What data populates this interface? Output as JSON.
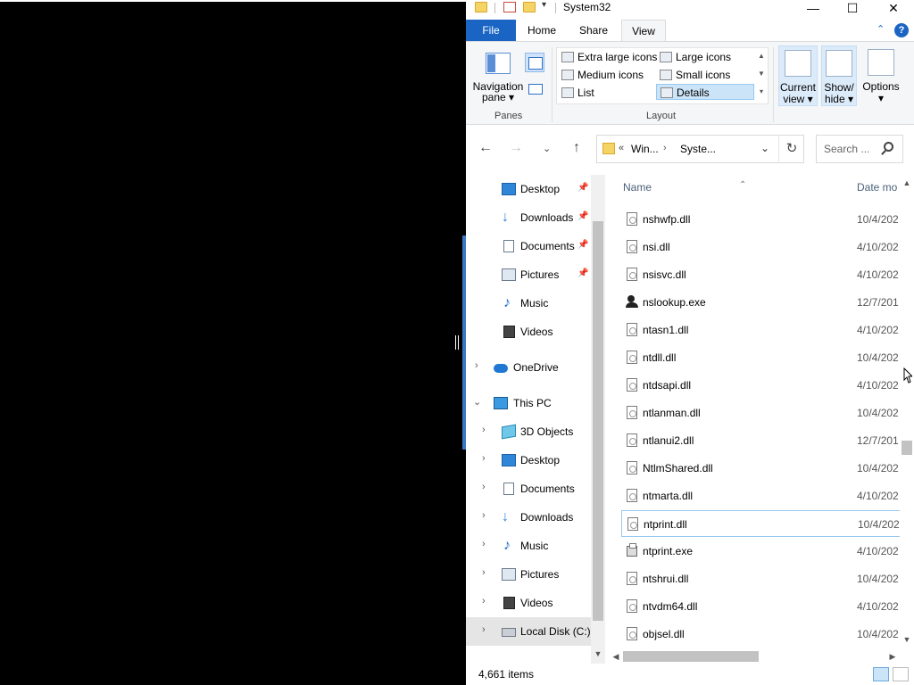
{
  "window": {
    "title": "System32",
    "minimize": "—",
    "maximize": "☐",
    "close": "✕"
  },
  "ribbon": {
    "tabs": {
      "file": "File",
      "home": "Home",
      "share": "Share",
      "view": "View"
    },
    "panes": {
      "navigation_pane": "Navigation pane",
      "group_label": "Panes"
    },
    "layout": {
      "group_label": "Layout",
      "options": [
        {
          "label": "Extra large icons",
          "selected": false
        },
        {
          "label": "Large icons",
          "selected": false
        },
        {
          "label": "Medium icons",
          "selected": false
        },
        {
          "label": "Small icons",
          "selected": false
        },
        {
          "label": "List",
          "selected": false
        },
        {
          "label": "Details",
          "selected": true
        }
      ]
    },
    "current_view": "Current view",
    "show_hide": "Show/ hide",
    "options": "Options"
  },
  "address": {
    "chevrons": "«",
    "segments": [
      "Win...",
      "Syste..."
    ],
    "separator": "›"
  },
  "search": {
    "placeholder": "Search ..."
  },
  "nav": {
    "quick_access": [
      {
        "label": "Desktop",
        "icon": "desktop-icon",
        "pinned": true
      },
      {
        "label": "Downloads",
        "icon": "download-icon",
        "pinned": true
      },
      {
        "label": "Documents",
        "icon": "document-icon",
        "pinned": true
      },
      {
        "label": "Pictures",
        "icon": "pictures-icon",
        "pinned": true
      },
      {
        "label": "Music",
        "icon": "music-icon",
        "pinned": false
      },
      {
        "label": "Videos",
        "icon": "videos-icon",
        "pinned": false
      }
    ],
    "onedrive": "OneDrive",
    "this_pc": "This PC",
    "this_pc_children": [
      {
        "label": "3D Objects",
        "icon": "3d-objects-icon"
      },
      {
        "label": "Desktop",
        "icon": "desktop-icon"
      },
      {
        "label": "Documents",
        "icon": "document-icon"
      },
      {
        "label": "Downloads",
        "icon": "download-icon"
      },
      {
        "label": "Music",
        "icon": "music-icon"
      },
      {
        "label": "Pictures",
        "icon": "pictures-icon"
      },
      {
        "label": "Videos",
        "icon": "videos-icon"
      },
      {
        "label": "Local Disk (C:)",
        "icon": "disk-icon",
        "selected": true
      }
    ]
  },
  "file_list": {
    "columns": {
      "name": "Name",
      "date_modified": "Date mo"
    },
    "files": [
      {
        "name": "nshwfp.dll",
        "date": "10/4/202",
        "type": "dll"
      },
      {
        "name": "nsi.dll",
        "date": "4/10/202",
        "type": "dll"
      },
      {
        "name": "nsisvc.dll",
        "date": "4/10/202",
        "type": "dll"
      },
      {
        "name": "nslookup.exe",
        "date": "12/7/201",
        "type": "exe"
      },
      {
        "name": "ntasn1.dll",
        "date": "4/10/202",
        "type": "dll"
      },
      {
        "name": "ntdll.dll",
        "date": "10/4/202",
        "type": "dll"
      },
      {
        "name": "ntdsapi.dll",
        "date": "4/10/202",
        "type": "dll"
      },
      {
        "name": "ntlanman.dll",
        "date": "10/4/202",
        "type": "dll"
      },
      {
        "name": "ntlanui2.dll",
        "date": "12/7/201",
        "type": "dll"
      },
      {
        "name": "NtlmShared.dll",
        "date": "10/4/202",
        "type": "dll"
      },
      {
        "name": "ntmarta.dll",
        "date": "4/10/202",
        "type": "dll"
      },
      {
        "name": "ntprint.dll",
        "date": "10/4/202",
        "type": "dll",
        "focused": true
      },
      {
        "name": "ntprint.exe",
        "date": "4/10/202",
        "type": "printer"
      },
      {
        "name": "ntshrui.dll",
        "date": "10/4/202",
        "type": "dll"
      },
      {
        "name": "ntvdm64.dll",
        "date": "4/10/202",
        "type": "dll"
      },
      {
        "name": "objsel.dll",
        "date": "10/4/202",
        "type": "dll"
      }
    ]
  },
  "status": {
    "item_count": "4,661 items"
  },
  "colors": {
    "accent": "#1a65c4",
    "selection": "#cce4f7",
    "folder": "#f6d365"
  }
}
